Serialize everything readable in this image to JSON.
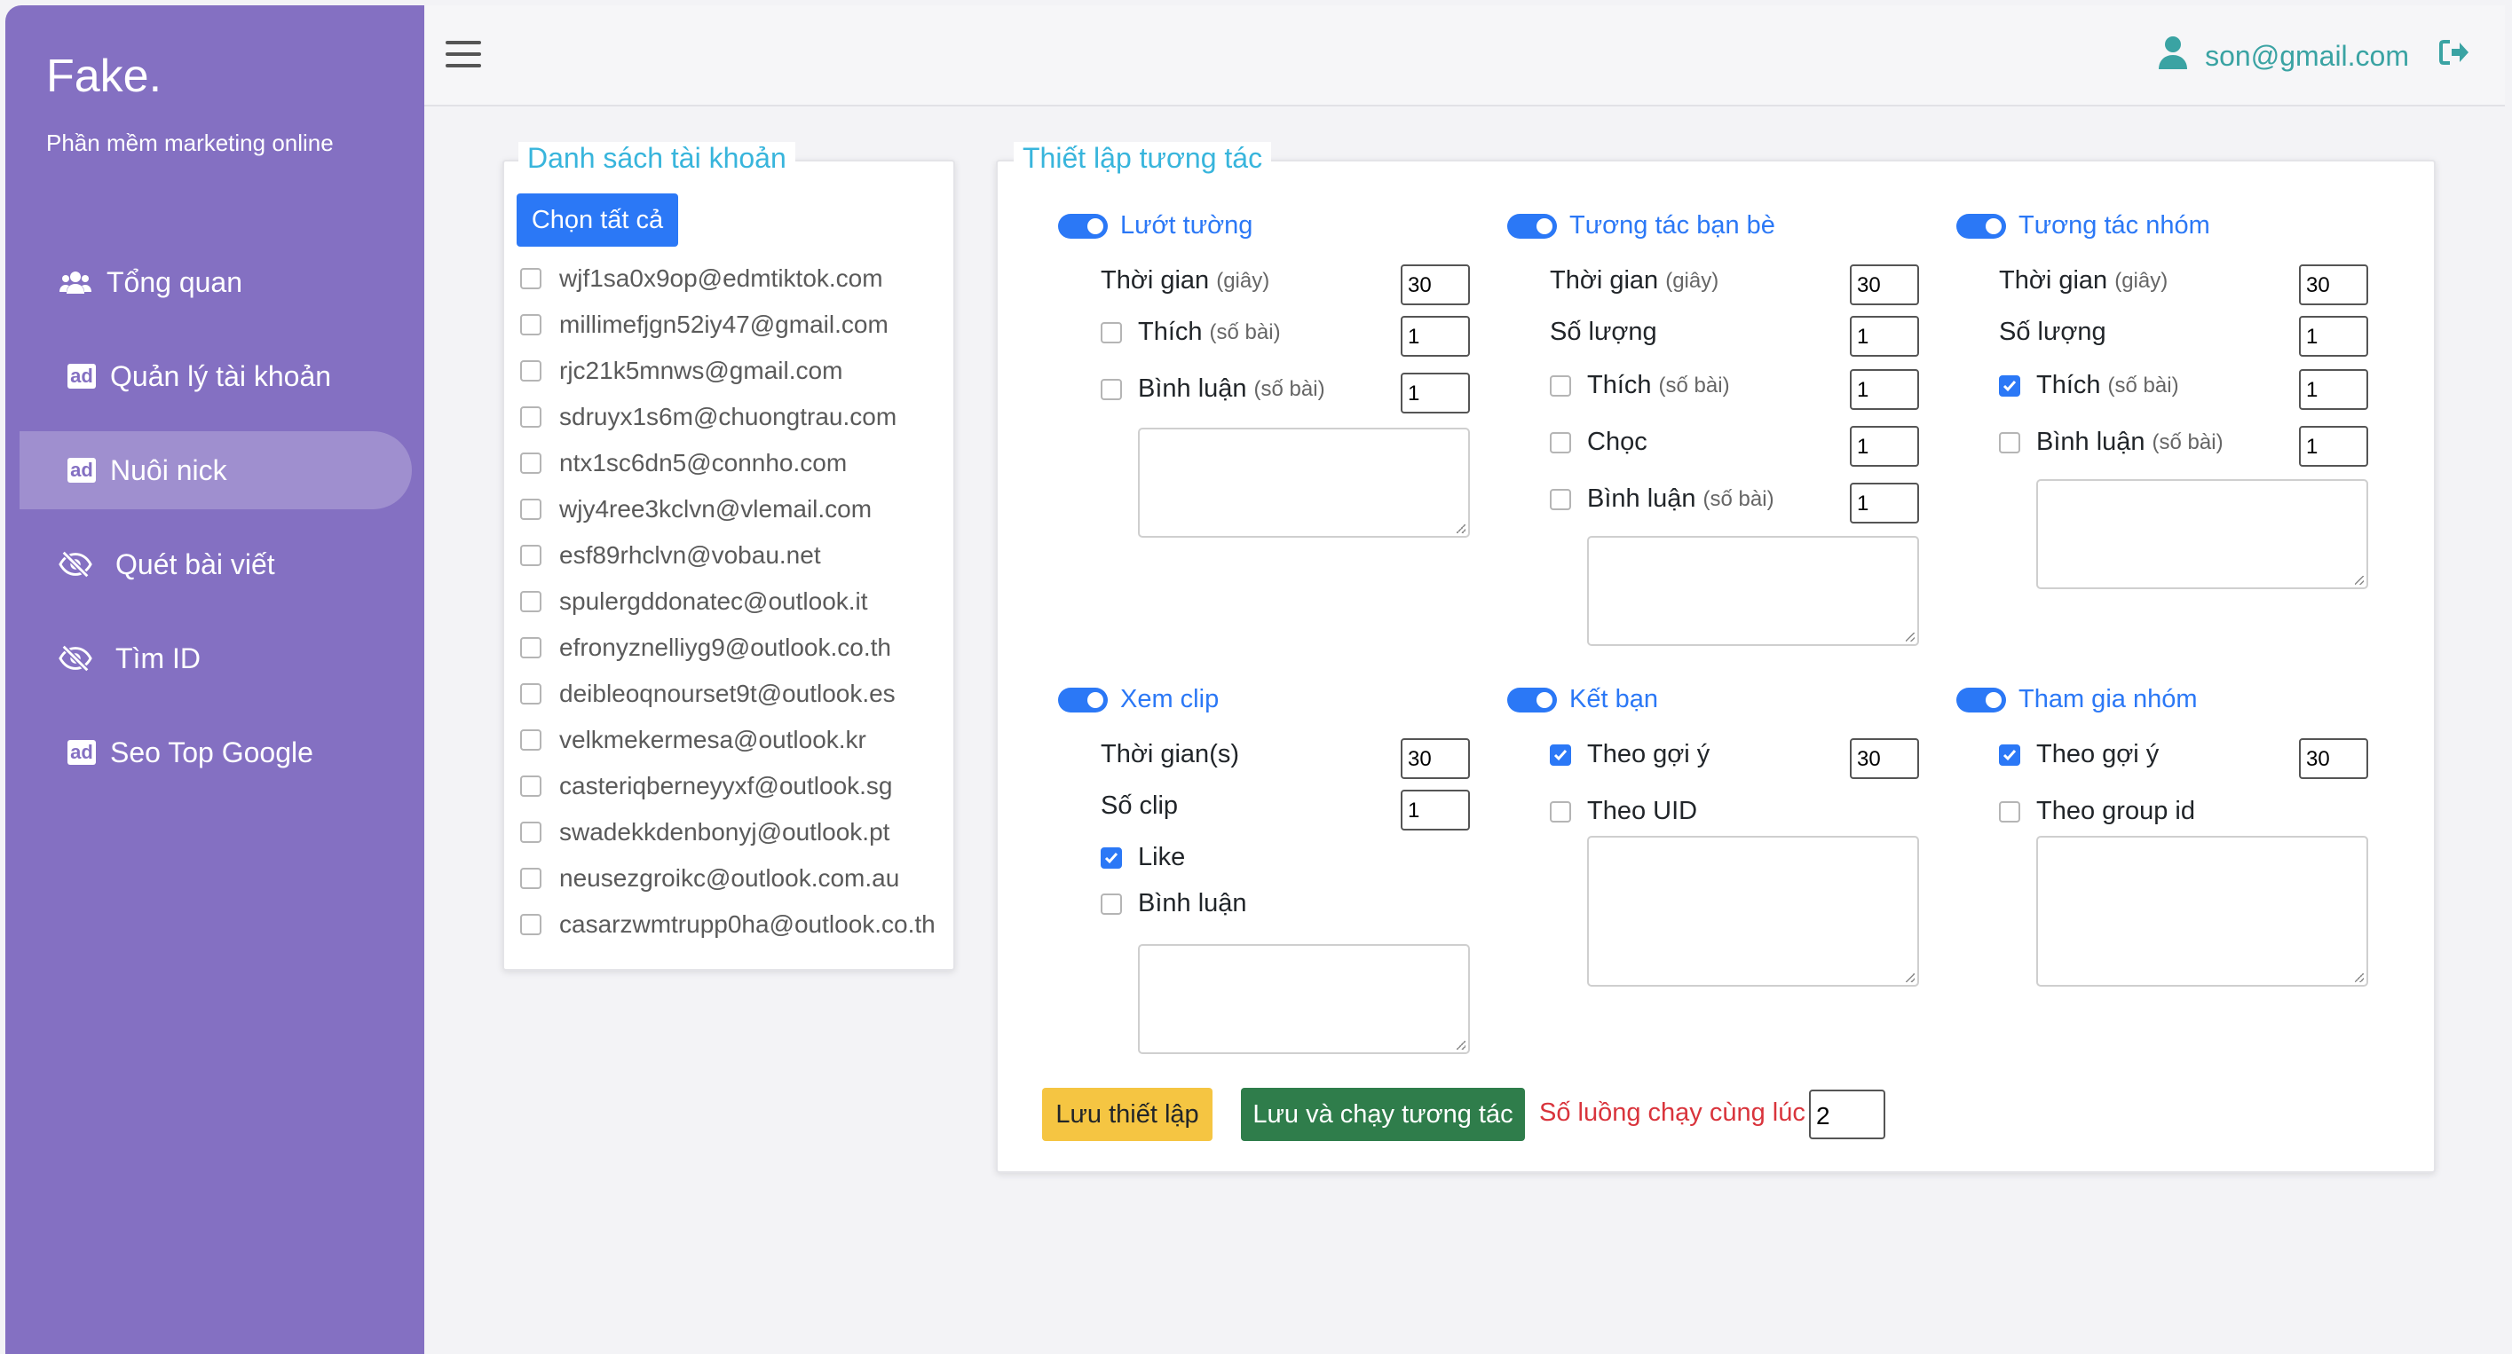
{
  "sidebar": {
    "brand": "Fake.",
    "tagline": "Phần mềm marketing online",
    "items": [
      {
        "label": "Tổng quan"
      },
      {
        "label": "Quản lý tài khoản"
      },
      {
        "label": "Nuôi nick"
      },
      {
        "label": "Quét bài viết"
      },
      {
        "label": "Tìm ID"
      },
      {
        "label": "Seo Top Google"
      }
    ],
    "active_item": "Nuôi nick"
  },
  "topbar": {
    "user_email": "son@gmail.com"
  },
  "accounts": {
    "title": "Danh sách tài khoản",
    "select_all": "Chọn tất cả",
    "items": [
      "wjf1sa0x9op@edmtiktok.com",
      "millimefjgn52iy47@gmail.com",
      "rjc21k5mnws@gmail.com",
      "sdruyx1s6m@chuongtrau.com",
      "ntx1sc6dn5@connho.com",
      "wjy4ree3kclvn@vlemail.com",
      "esf89rhclvn@vobau.net",
      "spulergddonatec@outlook.it",
      "efronyznelliyg9@outlook.co.th",
      "deibleoqnourset9t@outlook.es",
      "velkmekermesa@outlook.kr",
      "casteriqberneyyxf@outlook.sg",
      "swadekkdenbonyj@outlook.pt",
      "neusezgroikc@outlook.com.au",
      "casarzwmtrupp0ha@outlook.co.th"
    ]
  },
  "settings": {
    "title": "Thiết lập tương tác",
    "feed": {
      "title": "Lướt tường",
      "time_label": "Thời gian",
      "time_unit": "(giây)",
      "time_value": "30",
      "like_label": "Thích",
      "like_unit": "(số bài)",
      "like_value": "1",
      "like_checked": false,
      "comment_label": "Bình luận",
      "comment_unit": "(số bài)",
      "comment_value": "1",
      "comment_checked": false
    },
    "friends": {
      "title": "Tương tác bạn bè",
      "time_label": "Thời gian",
      "time_unit": "(giây)",
      "time_value": "30",
      "count_label": "Số lượng",
      "count_value": "1",
      "like_label": "Thích",
      "like_unit": "(số bài)",
      "like_value": "1",
      "like_checked": false,
      "poke_label": "Chọc",
      "poke_value": "1",
      "poke_checked": false,
      "comment_label": "Bình luận",
      "comment_unit": "(số bài)",
      "comment_value": "1",
      "comment_checked": false
    },
    "groups": {
      "title": "Tương tác nhóm",
      "time_label": "Thời gian",
      "time_unit": "(giây)",
      "time_value": "30",
      "count_label": "Số lượng",
      "count_value": "1",
      "like_label": "Thích",
      "like_unit": "(số bài)",
      "like_value": "1",
      "like_checked": true,
      "comment_label": "Bình luận",
      "comment_unit": "(số bài)",
      "comment_value": "1",
      "comment_checked": false
    },
    "clip": {
      "title": "Xem clip",
      "time_label": "Thời gian(s)",
      "time_value": "30",
      "count_label": "Số clip",
      "count_value": "1",
      "like_label": "Like",
      "like_checked": true,
      "comment_label": "Bình luận",
      "comment_checked": false
    },
    "add_friend": {
      "title": "Kết bạn",
      "suggest_label": "Theo gợi ý",
      "suggest_value": "30",
      "suggest_checked": true,
      "uid_label": "Theo UID",
      "uid_checked": false
    },
    "join_group": {
      "title": "Tham gia nhóm",
      "suggest_label": "Theo gợi ý",
      "suggest_value": "30",
      "suggest_checked": true,
      "gid_label": "Theo group id",
      "gid_checked": false
    },
    "save_label": "Lưu thiết lập",
    "save_run_label": "Lưu và chạy tương tác",
    "threads_label": "Số luồng chạy cùng lúc",
    "threads_value": "2"
  }
}
